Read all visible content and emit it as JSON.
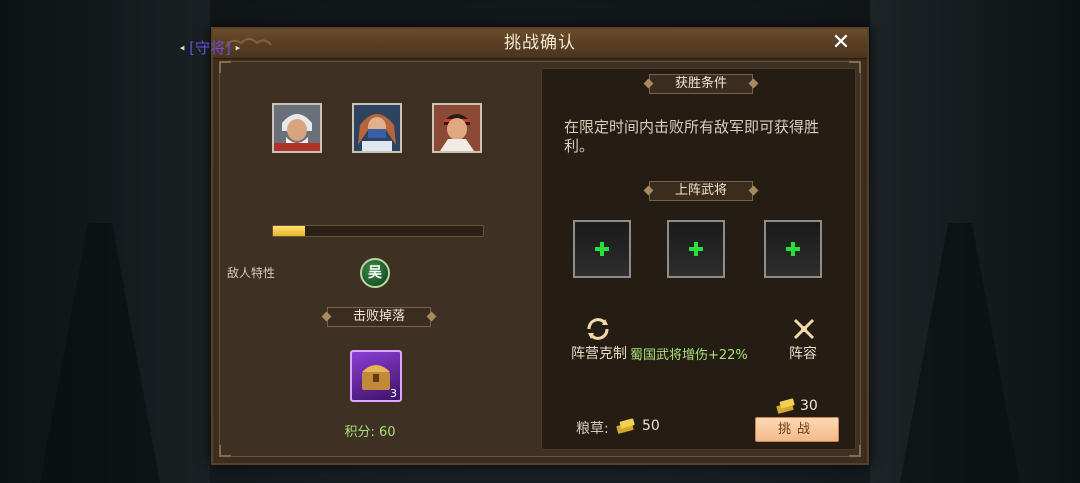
{
  "dialog": {
    "title": "挑战确认",
    "close_label": "✕"
  },
  "boss": {
    "label": "[守将]",
    "prev_arrow": "◂",
    "next_arrow": "▸"
  },
  "heroes": [
    {
      "name": "hero-portrait-1",
      "icon": "white-haired-general-portrait"
    },
    {
      "name": "hero-portrait-2",
      "icon": "masked-warrior-portrait"
    },
    {
      "name": "hero-portrait-3",
      "icon": "red-headband-warrior-portrait"
    }
  ],
  "progress": {
    "fraction": 0.15,
    "color": "#e8b323"
  },
  "enemy_trait": {
    "label": "敌人特性",
    "icon_text": "吴"
  },
  "drops": {
    "title": "击败掉落",
    "chest_count": "3",
    "score": "积分: 60"
  },
  "win_condition": {
    "title": "获胜条件",
    "text": "在限定时间内击败所有敌军即可获得胜利。"
  },
  "lineup": {
    "title": "上阵武将",
    "slot_count": 3
  },
  "faction": {
    "label": "阵营克制",
    "bonus": "蜀国武将增伤+22%"
  },
  "formation": {
    "label": "阵容"
  },
  "cost": {
    "food_label": "粮草:",
    "food_value": "50",
    "challenge_cost": "30"
  },
  "challenge_button": {
    "label": "挑战"
  },
  "colors": {
    "accent_green": "#a8e07a",
    "boss_purple": "#6a4fd8",
    "button_peach": "#f3b98a"
  }
}
